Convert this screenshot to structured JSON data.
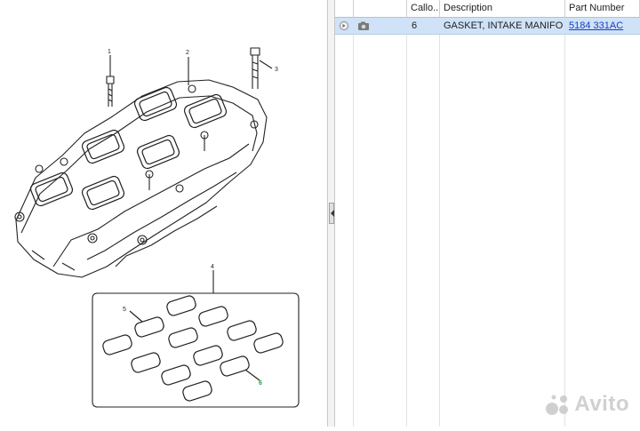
{
  "diagram": {
    "callouts": [
      "1",
      "2",
      "3",
      "4",
      "5",
      "6"
    ]
  },
  "table": {
    "headers": {
      "callout": "Callo...",
      "description": "Description",
      "part_number": "Part Number"
    },
    "rows": [
      {
        "callout": "6",
        "description": "GASKET, INTAKE MANIFOLD",
        "part_number": "5184 331AC",
        "icons": [
          "expand-icon",
          "camera-icon"
        ]
      }
    ]
  },
  "watermark": {
    "text": "Avito"
  },
  "colors": {
    "selected_row": "#cfe2f7",
    "link": "#1a3fc4",
    "highlight_callout": "#2aa24a"
  }
}
